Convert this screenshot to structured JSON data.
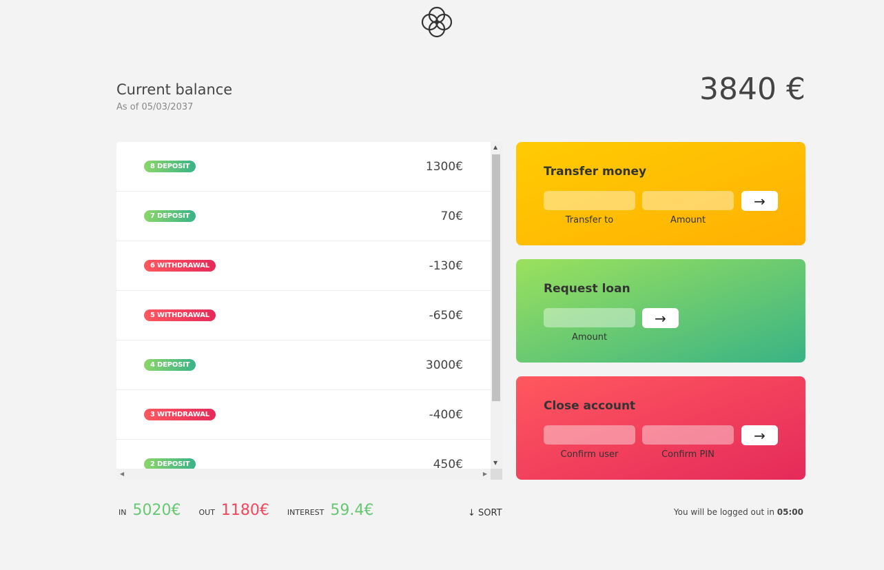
{
  "balance": {
    "label": "Current balance",
    "date_prefix": "As of",
    "date": "As of 05/03/2037",
    "value": "3840 €"
  },
  "movements": [
    {
      "type_label": "8 deposit",
      "type": "deposit",
      "value": "1300€"
    },
    {
      "type_label": "7 deposit",
      "type": "deposit",
      "value": "70€"
    },
    {
      "type_label": "6 withdrawal",
      "type": "withdrawal",
      "value": "-130€"
    },
    {
      "type_label": "5 withdrawal",
      "type": "withdrawal",
      "value": "-650€"
    },
    {
      "type_label": "4 deposit",
      "type": "deposit",
      "value": "3000€"
    },
    {
      "type_label": "3 withdrawal",
      "type": "withdrawal",
      "value": "-400€"
    },
    {
      "type_label": "2 deposit",
      "type": "deposit",
      "value": "450€"
    }
  ],
  "operations": {
    "transfer": {
      "title": "Transfer money",
      "to_label": "Transfer to",
      "amount_label": "Amount",
      "button": "→"
    },
    "loan": {
      "title": "Request loan",
      "amount_label": "Amount",
      "button": "→"
    },
    "close": {
      "title": "Close account",
      "user_label": "Confirm user",
      "pin_label": "Confirm PIN",
      "button": "→"
    }
  },
  "summary": {
    "in_label": "In",
    "in_value": "5020€",
    "out_label": "Out",
    "out_value": "1180€",
    "interest_label": "Interest",
    "interest_value": "59.4€",
    "sort_label": "↓ SORT"
  },
  "logout": {
    "text": "You will be logged out in",
    "timer": "05:00"
  },
  "colors": {
    "deposit": "#39b385",
    "withdrawal": "#e52a5a",
    "transfer": "#ffb003",
    "loan": "#39b385",
    "close": "#e52a5a"
  }
}
